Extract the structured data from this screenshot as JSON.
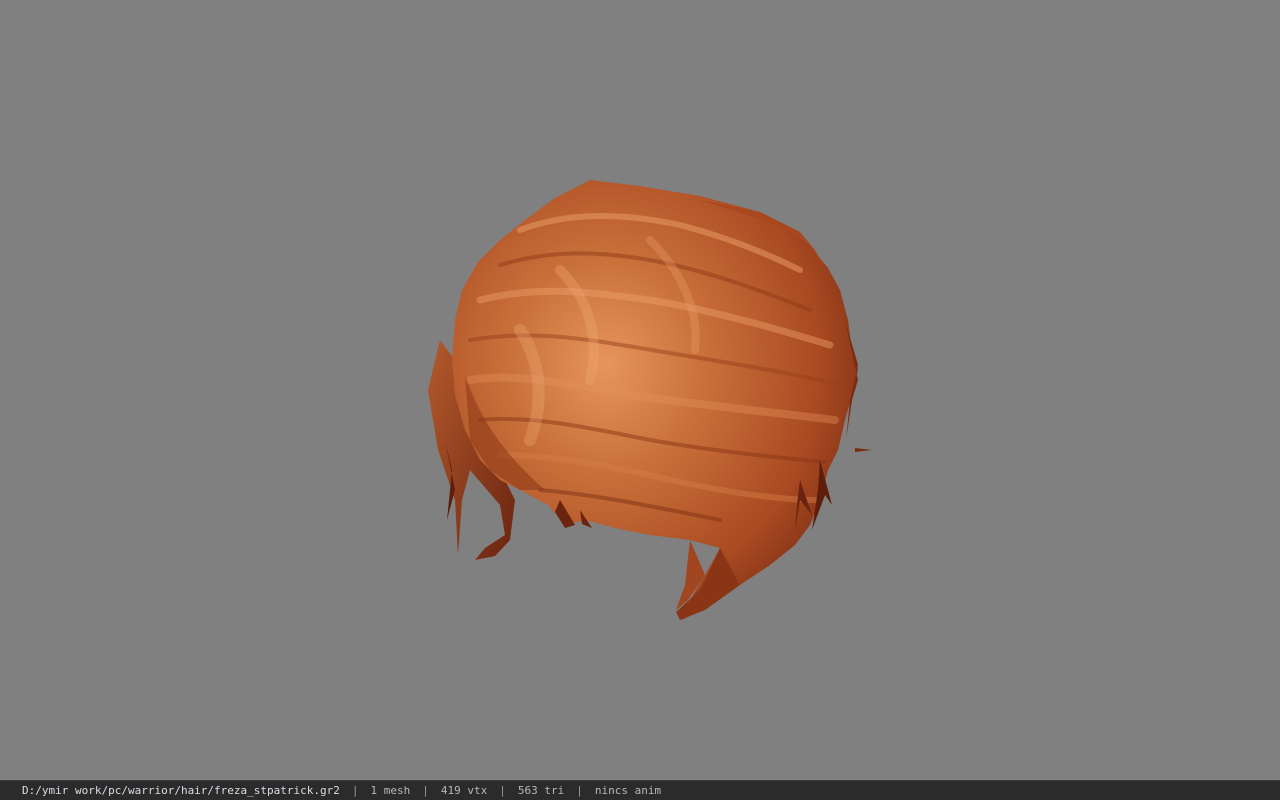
{
  "viewport": {
    "background_color": "#808080",
    "model": {
      "kind": "hair-mesh",
      "base_color": "#b4532a",
      "highlight_color": "#e08a55",
      "shadow_color": "#6e2410"
    }
  },
  "statusbar": {
    "file_path": "D:/ymir work/pc/warrior/hair/freza_stpatrick.gr2",
    "separator": "|",
    "mesh_count": "1 mesh",
    "vertex_count": "419 vtx",
    "triangle_count": "563 tri",
    "anim_status": "nincs anim"
  }
}
